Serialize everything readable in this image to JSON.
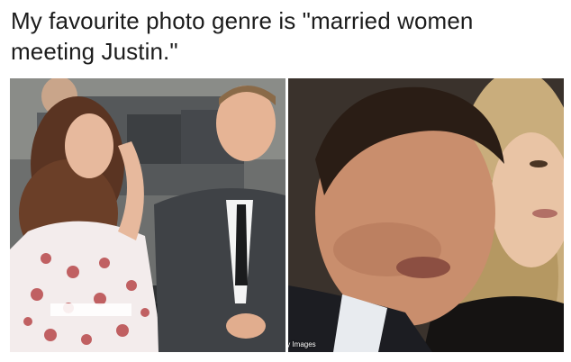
{
  "tweet": {
    "text": "My favourite photo genre is \"married women meeting Justin.\""
  },
  "photos": {
    "left": {
      "icon": "photo-couple-greeting-crowd"
    },
    "right": {
      "icon": "photo-man-blurred-foreground-woman-behind",
      "watermark": "ty Images"
    }
  },
  "colors": {
    "background": "#ffffff",
    "text": "#1c1c1c"
  }
}
